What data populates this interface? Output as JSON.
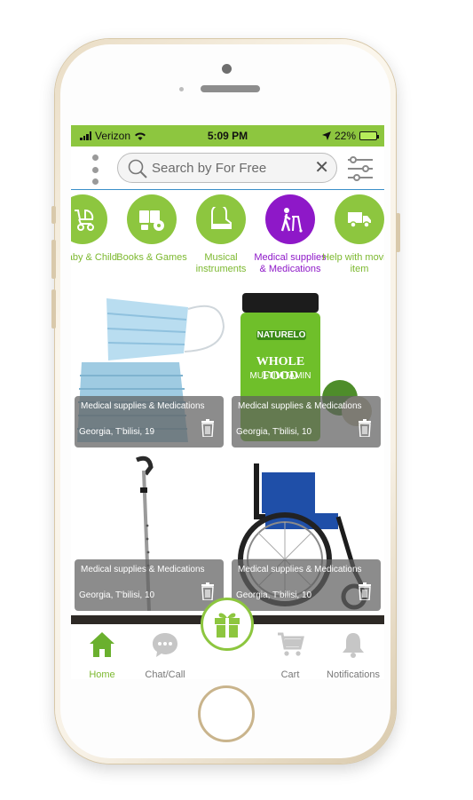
{
  "status_bar": {
    "carrier": "Verizon",
    "time": "5:09 PM",
    "battery": "22%"
  },
  "search": {
    "placeholder": "Search by For Free"
  },
  "categories": [
    {
      "label": "Baby & Child",
      "icon": "stroller-icon",
      "active": false
    },
    {
      "label": "Books & Games",
      "icon": "books-games-icon",
      "active": false
    },
    {
      "label": "Musical instruments",
      "icon": "piano-icon",
      "active": false
    },
    {
      "label": "Medical supplies & Medications",
      "icon": "walker-icon",
      "active": true
    },
    {
      "label": "Help with moving item",
      "icon": "truck-icon",
      "active": false
    }
  ],
  "listings": [
    {
      "category": "Medical supplies & Medications",
      "location": "Georgia, T'bilisi, 19",
      "image": "face-masks"
    },
    {
      "category": "Medical supplies & Medications",
      "location": "Georgia, T'bilisi, 10",
      "image": "multivitamin-bottle"
    },
    {
      "category": "Medical supplies & Medications",
      "location": "Georgia, T'bilisi, 10",
      "image": "crutch"
    },
    {
      "category": "Medical supplies & Medications",
      "location": "Georgia, T'bilisi, 10",
      "image": "wheelchair"
    }
  ],
  "product_label": {
    "brand": "NATURELO",
    "line1": "WHOLE FOOD",
    "line2": "MULTIVITAMIN"
  },
  "tabs": [
    {
      "label": "Home",
      "icon": "home-icon",
      "active": true
    },
    {
      "label": "Chat/Call",
      "icon": "chat-icon",
      "active": false
    },
    {
      "label": "Cart",
      "icon": "cart-icon",
      "active": false
    },
    {
      "label": "Notifications",
      "icon": "bell-icon",
      "active": false
    }
  ],
  "colors": {
    "accent": "#8dc63f",
    "active_category": "#8e18c8"
  }
}
